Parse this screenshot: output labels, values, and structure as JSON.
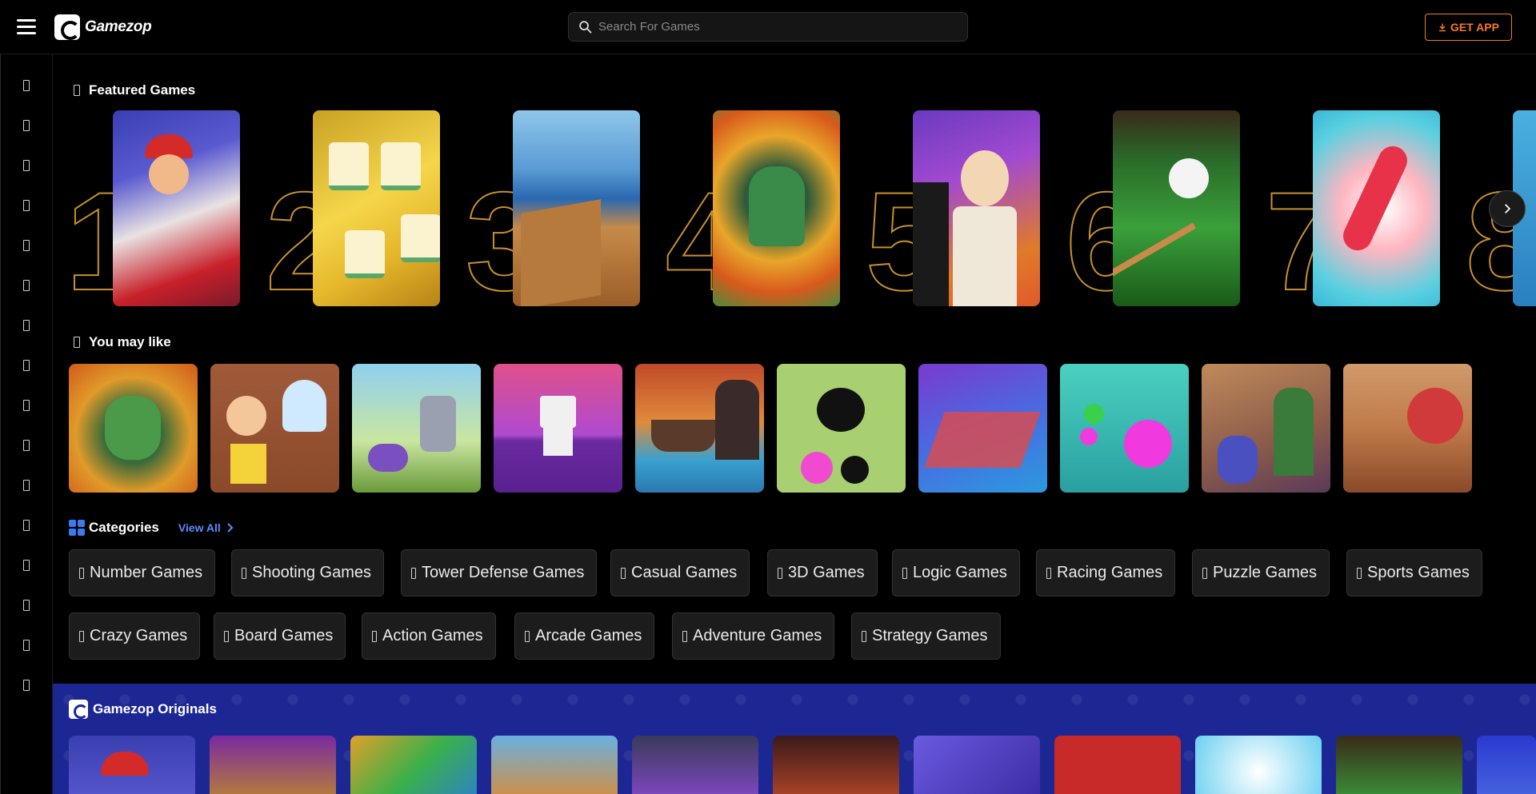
{
  "header": {
    "brand": "Gamezop",
    "search_placeholder": "Search For Games",
    "get_app_label": "GET APP"
  },
  "sidebar": {
    "icon_count": 16
  },
  "featured": {
    "title": "Featured Games",
    "items": [
      {
        "rank": "1"
      },
      {
        "rank": "2"
      },
      {
        "rank": "3"
      },
      {
        "rank": "4"
      },
      {
        "rank": "5"
      },
      {
        "rank": "6"
      },
      {
        "rank": "7"
      },
      {
        "rank": "8"
      }
    ]
  },
  "you_may_like": {
    "title": "You may like"
  },
  "categories": {
    "title": "Categories",
    "view_all": "View All",
    "row1": [
      "Number Games",
      "Shooting Games",
      "Tower Defense Games",
      "Casual Games",
      "3D Games",
      "Logic Games",
      "Racing Games",
      "Puzzle Games",
      "Sports Games"
    ],
    "row2": [
      "Crazy Games",
      "Board Games",
      "Action Games",
      "Arcade Games",
      "Adventure Games",
      "Strategy Games"
    ]
  },
  "originals": {
    "title": "Gamezop Originals"
  },
  "colors": {
    "accent_orange": "#f47a23",
    "link_blue": "#5a8cff",
    "originals_bg": "#1d2794",
    "featured_number_outline": "#c8902a"
  }
}
